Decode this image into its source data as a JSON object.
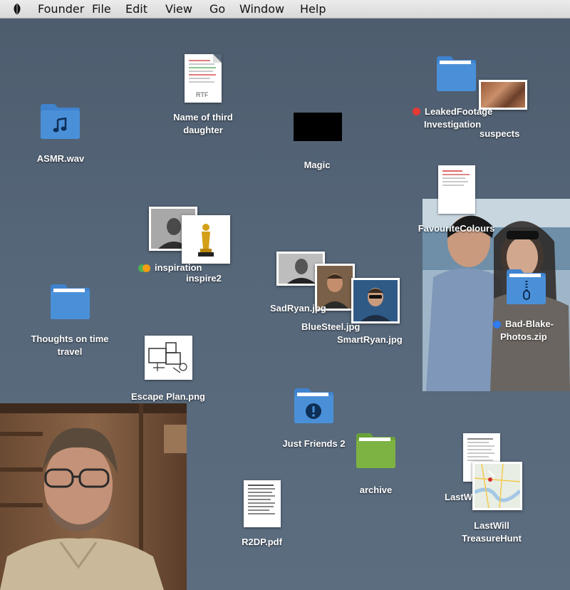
{
  "menubar": {
    "app_name": "Founder",
    "items": [
      "File",
      "Edit",
      "View",
      "Go",
      "Window",
      "Help"
    ]
  },
  "desktop": {
    "asmr": {
      "label": "ASMR.wav"
    },
    "rtf": {
      "label_line1": "Name of third",
      "label_line2": "daughter",
      "badge": "RTF"
    },
    "magic": {
      "label": "Magic"
    },
    "leaked": {
      "label_line1": "LeakedFootage",
      "label_line2": "Investigation",
      "extra": "suspects"
    },
    "favourite": {
      "label": "FavouriteColours"
    },
    "inspiration": {
      "label1": "inspiration",
      "label2": "inspire2"
    },
    "thoughts": {
      "label_line1": "Thoughts on  time",
      "label_line2": "travel"
    },
    "sadryan": {
      "label": "SadRyan.jpg"
    },
    "bluesteel": {
      "label": "BlueSteel.jpg"
    },
    "smartryan": {
      "label": "SmartRyan.jpg"
    },
    "badblake": {
      "label_line1": "Bad-Blake-",
      "label_line2": "Photos.zip"
    },
    "escape": {
      "label": "Escape Plan.png"
    },
    "justfriends": {
      "label": "Just Friends 2"
    },
    "archive": {
      "label": "archive"
    },
    "lastwill": {
      "label_partial": "LastW",
      "label_line1": "LastWill",
      "label_line2": "TreasureHunt"
    },
    "r2dp": {
      "label": "R2DP.pdf"
    }
  },
  "colors": {
    "folder_blue": "#4a90d9",
    "folder_green": "#7cb342",
    "tag_red": "#e53935",
    "tag_orange": "#f39c12",
    "tag_green": "#4caf50",
    "tag_blue": "#2f7bef"
  },
  "icons": {
    "asmr": "music-note-icon",
    "badblake": "zipper-icon",
    "justfriends": "exclamation-icon"
  }
}
